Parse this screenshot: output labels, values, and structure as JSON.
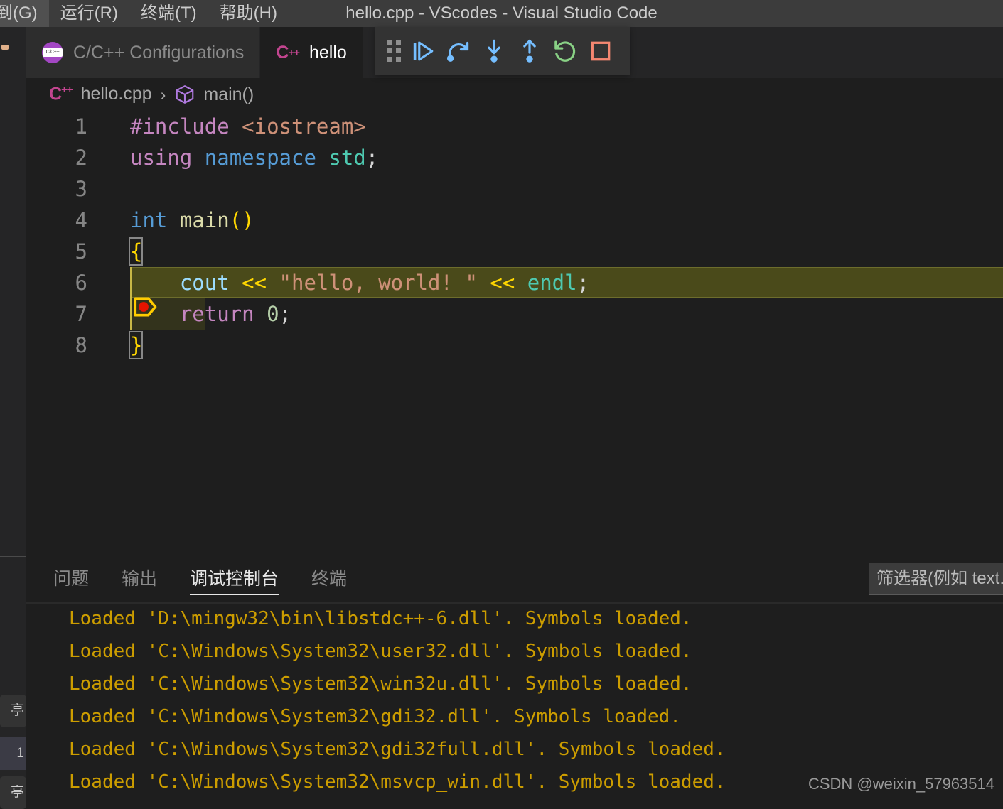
{
  "window": {
    "title": "hello.cpp - VScodes - Visual Studio Code"
  },
  "menubar": {
    "items": [
      {
        "label": "到(G)",
        "name": "menu-goto"
      },
      {
        "label": "运行(R)",
        "name": "menu-run"
      },
      {
        "label": "终端(T)",
        "name": "menu-terminal"
      },
      {
        "label": "帮助(H)",
        "name": "menu-help"
      }
    ]
  },
  "tabs": [
    {
      "label": "C/C++ Configurations",
      "icon": "cpp-config-icon",
      "active": false
    },
    {
      "label": "hello",
      "icon": "cpp-file-icon",
      "active": true
    }
  ],
  "debug_toolbar": {
    "buttons": [
      {
        "name": "drag-handle-icon",
        "title": "拖动",
        "color": "#8e8e8e"
      },
      {
        "name": "continue-icon",
        "title": "继续",
        "color": "#75beff"
      },
      {
        "name": "step-over-icon",
        "title": "单步跳过",
        "color": "#75beff"
      },
      {
        "name": "step-into-icon",
        "title": "单步调试",
        "color": "#75beff"
      },
      {
        "name": "step-out-icon",
        "title": "单步跳出",
        "color": "#75beff"
      },
      {
        "name": "restart-icon",
        "title": "重启",
        "color": "#89d185"
      },
      {
        "name": "stop-icon",
        "title": "停止",
        "color": "#f48771"
      }
    ]
  },
  "breadcrumb": {
    "file_icon": "cpp-file-icon",
    "file": "hello.cpp",
    "separator": "›",
    "symbol_icon": "cube-icon",
    "symbol": "main()"
  },
  "editor": {
    "lines": [
      {
        "number": "1",
        "tokens": [
          {
            "text": "#include",
            "cls": "t-pre"
          },
          {
            "text": " ",
            "cls": "t-plain"
          },
          {
            "text": "<iostream>",
            "cls": "t-str"
          }
        ]
      },
      {
        "number": "2",
        "tokens": [
          {
            "text": "using",
            "cls": "t-kw"
          },
          {
            "text": " ",
            "cls": "t-plain"
          },
          {
            "text": "namespace",
            "cls": "t-type"
          },
          {
            "text": " ",
            "cls": "t-plain"
          },
          {
            "text": "std",
            "cls": "t-ns"
          },
          {
            "text": ";",
            "cls": "t-plain"
          }
        ]
      },
      {
        "number": "3",
        "tokens": []
      },
      {
        "number": "4",
        "tokens": [
          {
            "text": "int",
            "cls": "t-type"
          },
          {
            "text": " ",
            "cls": "t-plain"
          },
          {
            "text": "main",
            "cls": "t-fn"
          },
          {
            "text": "()",
            "cls": "t-paren"
          }
        ]
      },
      {
        "number": "5",
        "bracket_box": true,
        "tokens": [
          {
            "text": "{",
            "cls": "t-brace"
          }
        ]
      },
      {
        "number": "6",
        "current": true,
        "breakpoint": true,
        "guide": true,
        "indent": "    ",
        "tokens": [
          {
            "text": "    ",
            "cls": "t-plain"
          },
          {
            "text": "cout",
            "cls": "t-var"
          },
          {
            "text": " ",
            "cls": "t-plain"
          },
          {
            "text": "<<",
            "cls": "t-paren"
          },
          {
            "text": " ",
            "cls": "t-plain"
          },
          {
            "text": "\"hello, world! \"",
            "cls": "t-str"
          },
          {
            "text": " ",
            "cls": "t-plain"
          },
          {
            "text": "<<",
            "cls": "t-paren"
          },
          {
            "text": " ",
            "cls": "t-plain"
          },
          {
            "text": "endl",
            "cls": "t-ns"
          },
          {
            "text": ";",
            "cls": "t-plain"
          }
        ]
      },
      {
        "number": "7",
        "selection": true,
        "guide": true,
        "tokens": [
          {
            "text": "    ",
            "cls": "t-plain"
          },
          {
            "text": "return",
            "cls": "t-kw"
          },
          {
            "text": " ",
            "cls": "t-plain"
          },
          {
            "text": "0",
            "cls": "t-num"
          },
          {
            "text": ";",
            "cls": "t-plain"
          }
        ]
      },
      {
        "number": "8",
        "bracket_box": true,
        "tokens": [
          {
            "text": "}",
            "cls": "t-brace"
          }
        ]
      }
    ]
  },
  "panel": {
    "tabs": [
      {
        "label": "问题",
        "active": false
      },
      {
        "label": "输出",
        "active": false
      },
      {
        "label": "调试控制台",
        "active": true
      },
      {
        "label": "终端",
        "active": false
      }
    ],
    "filter_placeholder": "筛选器(例如 text.",
    "filter_value": "",
    "console_lines": [
      "Loaded 'D:\\mingw32\\bin\\libstdc++-6.dll'. Symbols loaded.",
      "Loaded 'C:\\Windows\\System32\\user32.dll'. Symbols loaded.",
      "Loaded 'C:\\Windows\\System32\\win32u.dll'. Symbols loaded.",
      "Loaded 'C:\\Windows\\System32\\gdi32.dll'. Symbols loaded.",
      "Loaded 'C:\\Windows\\System32\\gdi32full.dll'. Symbols loaded.",
      "Loaded 'C:\\Windows\\System32\\msvcp_win.dll'. Symbols loaded."
    ]
  },
  "sidebar": {
    "fragments": [
      {
        "label": "亭",
        "selected": false
      },
      {
        "label": "1",
        "selected": true
      },
      {
        "label": "亭",
        "selected": false
      }
    ]
  },
  "watermark": "CSDN @weixin_57963514",
  "colors": {
    "accent_blue": "#75beff",
    "restart_green": "#89d185",
    "stop_red": "#f48771",
    "current_line": "#4a4a1a",
    "console_text": "#cc9d00",
    "breakpoint": "#e51400",
    "pointer": "#ffcc00"
  }
}
